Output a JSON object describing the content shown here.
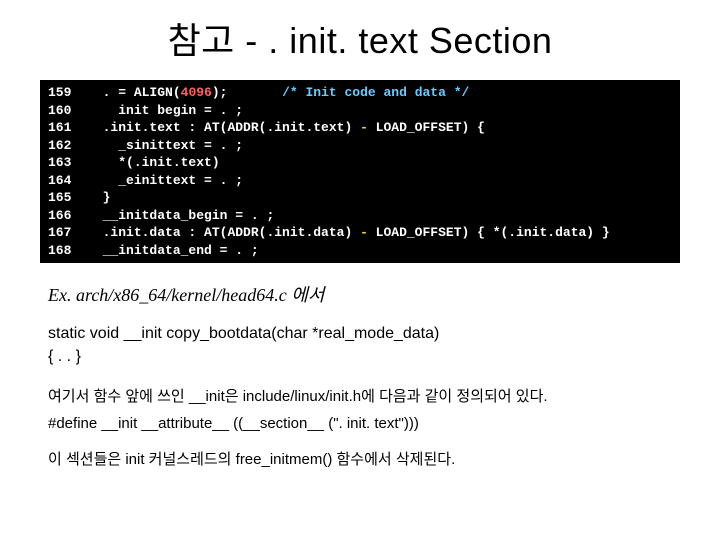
{
  "title": "참고 - . init. text Section",
  "code": {
    "lines": [
      {
        "num": "159",
        "text_parts": [
          "  . = ALIGN(",
          {
            "cls": "kw-num",
            "t": "4096"
          },
          ");       ",
          {
            "cls": "comment",
            "t": "/* Init code and data */"
          }
        ]
      },
      {
        "num": "160",
        "text_parts": [
          "    init begin = . ;"
        ]
      },
      {
        "num": "161",
        "text_parts": [
          "  .init.text : AT(ADDR(.init.text) ",
          {
            "cls": "yellow",
            "t": "-"
          },
          " LOAD_OFFSET) {"
        ]
      },
      {
        "num": "162",
        "text_parts": [
          "    _sinittext = . ;"
        ]
      },
      {
        "num": "163",
        "text_parts": [
          "    *(.init.text)"
        ]
      },
      {
        "num": "164",
        "text_parts": [
          "    _einittext = . ;"
        ]
      },
      {
        "num": "165",
        "text_parts": [
          "  }"
        ]
      },
      {
        "num": "166",
        "text_parts": [
          "  __initdata_begin = . ;"
        ]
      },
      {
        "num": "167",
        "text_parts": [
          "  .init.data : AT(ADDR(.init.data) ",
          {
            "cls": "yellow",
            "t": "-"
          },
          " LOAD_OFFSET) { *(.init.data) }"
        ]
      },
      {
        "num": "168",
        "text_parts": [
          "  __initdata_end = . ;"
        ]
      }
    ]
  },
  "example_label": "Ex. arch/x86_64/kernel/head64.c 에서",
  "func_line1": "static void __init copy_bootdata(char *real_mode_data)",
  "func_line2": "{ . . }",
  "body1a": "여기서 함수 앞에 쓰인 __init은 include/linux/init.h에 다음과 같이 정의되어 있다.",
  "body1b": "#define __init       __attribute__ ((__section__ (\". init. text\")))",
  "body2": "이 섹션들은 init 커널스레드의 free_initmem() 함수에서 삭제된다."
}
